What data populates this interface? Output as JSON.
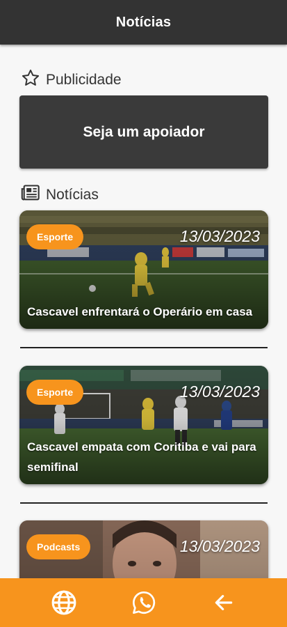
{
  "header": {
    "title": "Notícias"
  },
  "ads_section": {
    "icon": "star-outline-icon",
    "label": "Publicidade"
  },
  "support_banner": {
    "label": "Seja um apoiador"
  },
  "news_section": {
    "icon": "newspaper-icon",
    "label": "Notícias"
  },
  "news": [
    {
      "category": "Esporte",
      "date": "13/03/2023",
      "title": "Cascavel enfrentará o Operário em casa",
      "image": "soccer-match-photo"
    },
    {
      "category": "Esporte",
      "date": "13/03/2023",
      "title": "Cascavel empata com Coritiba e vai para semifinal",
      "image": "soccer-match-photo"
    },
    {
      "category": "Podcasts",
      "date": "13/03/2023",
      "title": "",
      "image": "podcast-guest-photo"
    }
  ],
  "bottom_nav": [
    {
      "icon": "globe-icon",
      "label": "Website"
    },
    {
      "icon": "whatsapp-icon",
      "label": "WhatsApp"
    },
    {
      "icon": "arrow-left-icon",
      "label": "Back"
    }
  ],
  "colors": {
    "accent": "#f7941d",
    "appbar": "#333333",
    "banner": "#3a3a3a",
    "background": "#f7f7f7"
  }
}
